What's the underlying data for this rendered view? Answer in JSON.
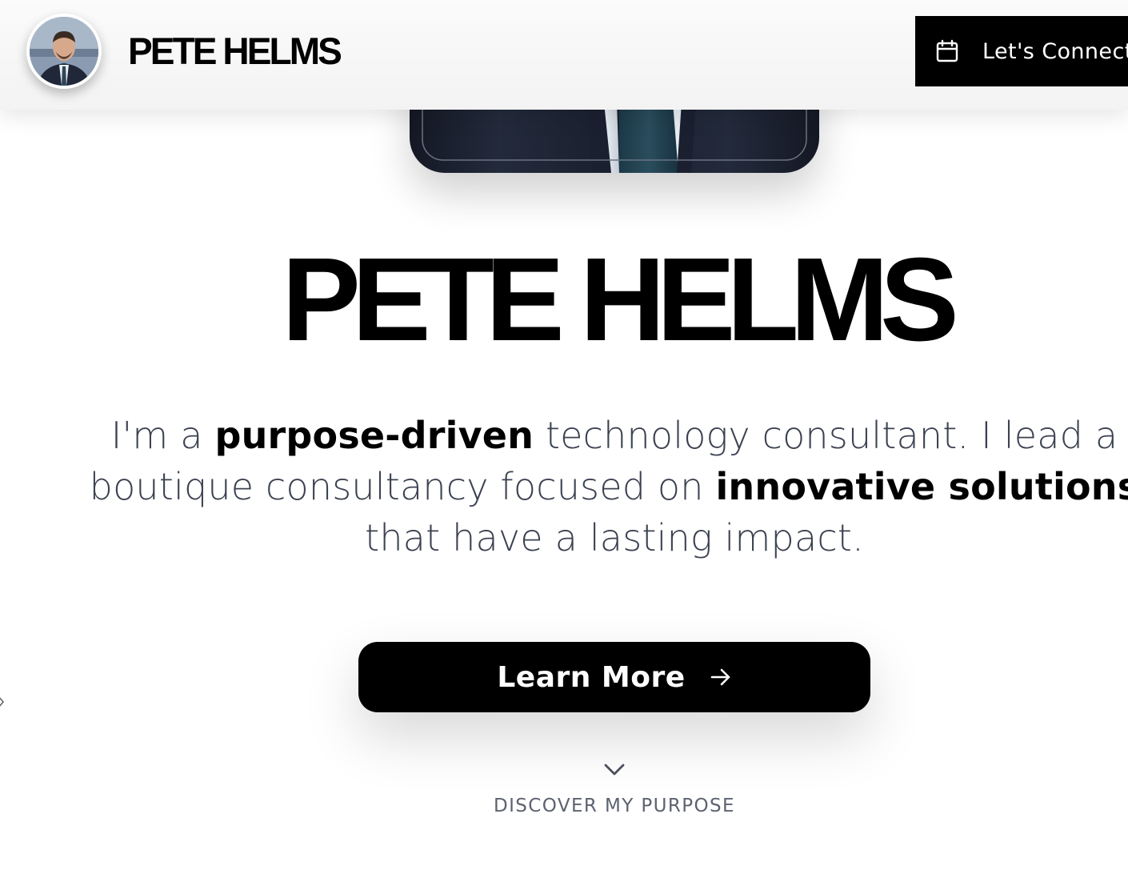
{
  "header": {
    "brand": "PETE HELMS",
    "connect_label": "Let's Connect",
    "connect_icon": "calendar-icon"
  },
  "hero": {
    "name": "PETE HELMS",
    "tagline": {
      "l1_a": "I'm a ",
      "l1_b": "purpose-driven",
      "l1_c": " technology consultant. I lead a",
      "l2_a": "boutique consultancy focused on ",
      "l2_b": "innovative solutions",
      "l3": "that have a lasting impact."
    },
    "learn_more_label": "Learn More",
    "learn_more_icon": "arrow-right-icon",
    "scroll_icon": "chevron-down-icon",
    "discover_label": "DISCOVER MY PURPOSE"
  },
  "colors": {
    "primary": "#000000",
    "text_muted": "#3b4150",
    "header_bg": "#f5f5f5",
    "background": "#ffffff"
  }
}
